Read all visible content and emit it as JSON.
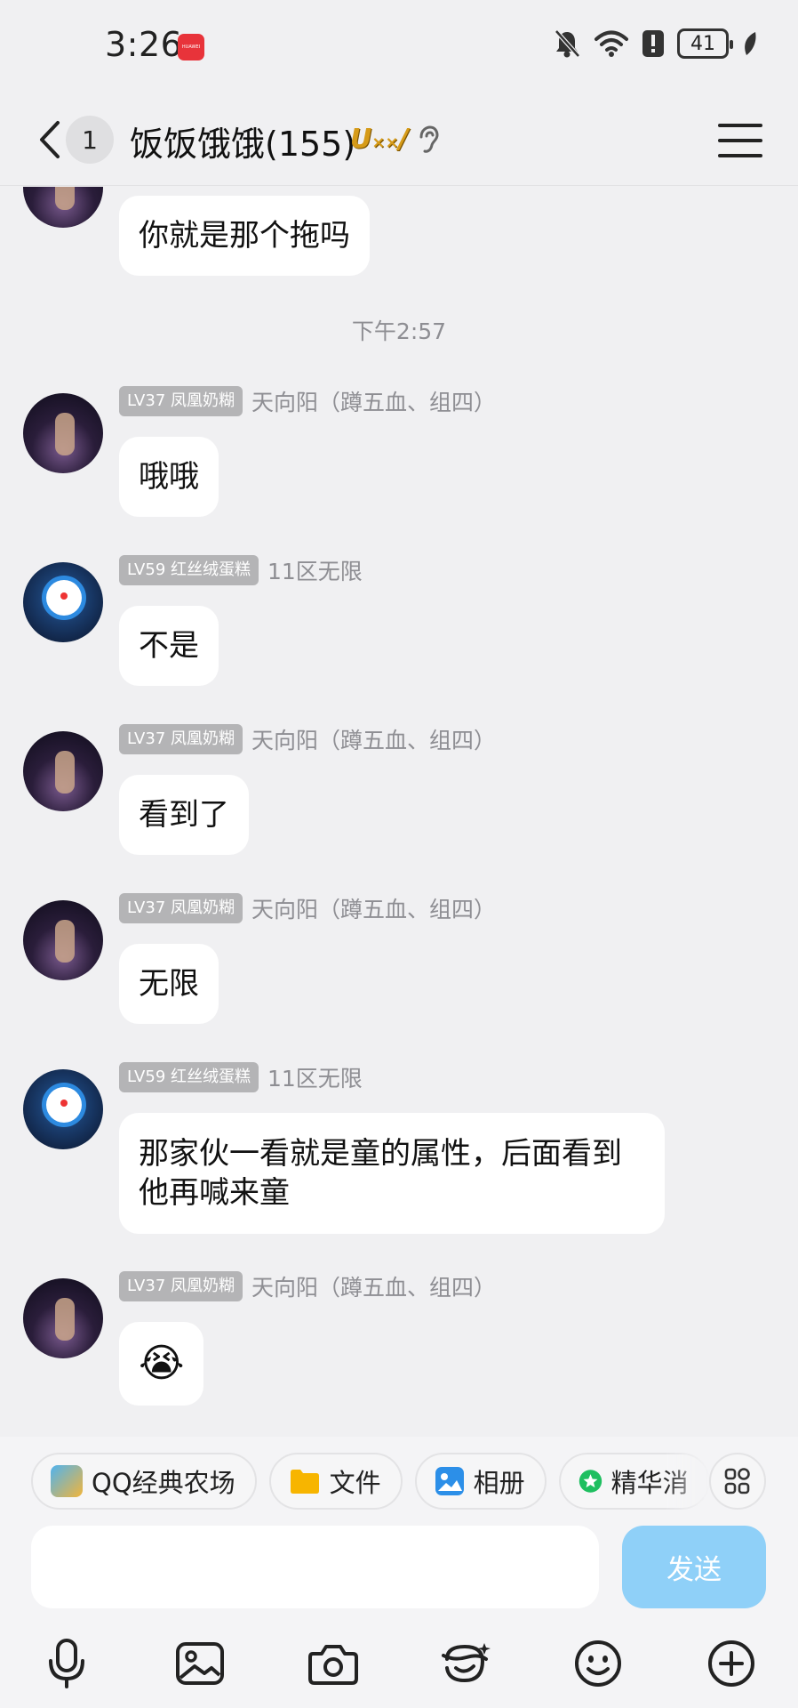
{
  "status_bar": {
    "time": "3:26",
    "battery": "41",
    "icons": [
      "huawei-app-icon",
      "bell-muted-icon",
      "wifi-icon",
      "alert-icon",
      "battery-icon",
      "leaf-icon"
    ]
  },
  "header": {
    "unread_count": "1",
    "title": "饭饭饿饿(155)",
    "badge_icons": [
      "vip-badge-icon",
      "ear-icon"
    ]
  },
  "messages": [
    {
      "type": "text",
      "avatar": "girl-avatar",
      "text": "你就是那个拖吗"
    },
    {
      "type": "timestamp",
      "text": "下午2:57"
    },
    {
      "type": "text",
      "level": "LV37 凤凰奶糊",
      "sender": "天向阳（蹲五血、组四）",
      "avatar": "girl-avatar",
      "text": "哦哦"
    },
    {
      "type": "text",
      "level": "LV59 红丝绒蛋糕",
      "sender": "11区无限",
      "avatar": "doraemon-avatar",
      "text": "不是"
    },
    {
      "type": "text",
      "level": "LV37 凤凰奶糊",
      "sender": "天向阳（蹲五血、组四）",
      "avatar": "girl-avatar",
      "text": "看到了"
    },
    {
      "type": "text",
      "level": "LV37 凤凰奶糊",
      "sender": "天向阳（蹲五血、组四）",
      "avatar": "girl-avatar",
      "text": "无限"
    },
    {
      "type": "text",
      "level": "LV59 红丝绒蛋糕",
      "sender": "11区无限",
      "avatar": "doraemon-avatar",
      "text": "那家伙一看就是童的属性，后面看到他再喊来童"
    },
    {
      "type": "emoji",
      "level": "LV37 凤凰奶糊",
      "sender": "天向阳（蹲五血、组四）",
      "avatar": "girl-avatar",
      "emoji": "😭"
    }
  ],
  "quick_actions": [
    {
      "label": "QQ经典农场",
      "icon": "farm-icon"
    },
    {
      "label": "文件",
      "icon": "folder-icon"
    },
    {
      "label": "相册",
      "icon": "album-icon"
    },
    {
      "label": "精华消",
      "icon": "star-icon"
    }
  ],
  "input": {
    "placeholder": "",
    "send_label": "发送"
  },
  "toolbar": [
    "microphone-icon",
    "image-icon",
    "camera-icon",
    "sticker-icon",
    "emoji-icon",
    "plus-icon"
  ],
  "colors": {
    "background": "#f0f0f2",
    "bubble": "#ffffff",
    "send_button": "#8fd0f8",
    "level_badge": "#b4b4b6"
  }
}
